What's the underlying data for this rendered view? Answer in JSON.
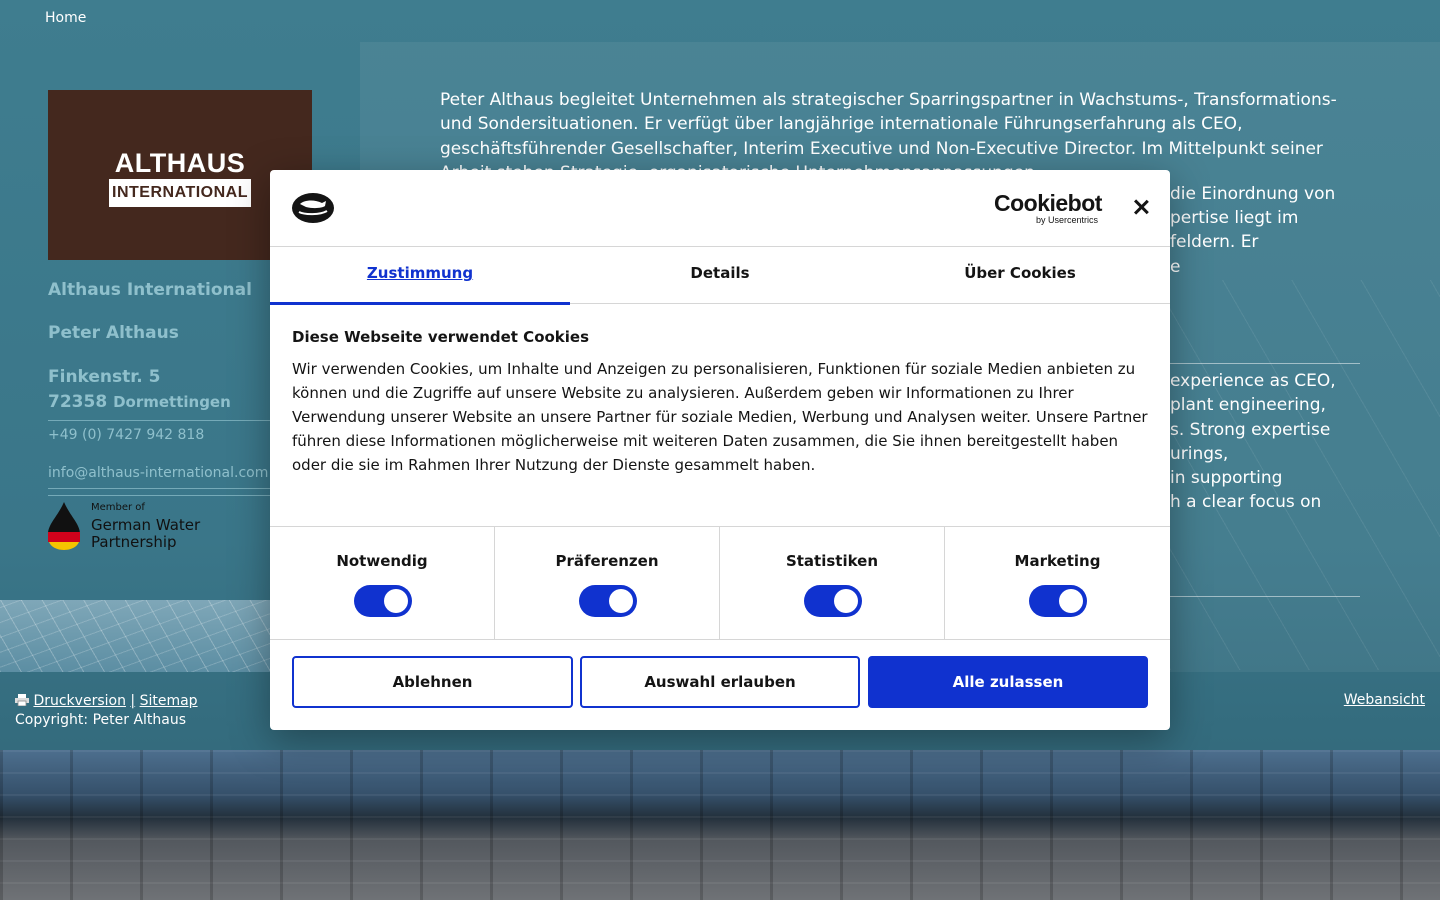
{
  "nav": {
    "home": "Home"
  },
  "sidebar": {
    "logo_line1": "ALTHAUS",
    "logo_line2": "INTERNATIONAL",
    "company": "Althaus International",
    "person": "Peter Althaus",
    "street": "Finkenstr. 5",
    "zip": "72358",
    "town": "Dormettingen",
    "phone": "+49 (0) 7427 942 818",
    "email": "info@althaus-international.com",
    "badge_member": "Member of",
    "badge_name_line1": "German Water",
    "badge_name_line2": "Partnership"
  },
  "main": {
    "intro": "Peter Althaus begleitet Unternehmen als strategischer Sparringspartner in Wachstums-, Transformations- und Sondersituationen. Er verfügt über langjährige internationale Führungserfahrung als CEO, geschäftsführender Gesellschafter, Interim Executive und Non-Executive Director. Im Mittelpunkt seiner Arbeit stehen Strategie, organisatorische Unternehmensanpassungen",
    "visible_fragments": [
      "die Einordnung von",
      "pertise liegt im",
      "feldern. Er",
      "e"
    ],
    "english_fragments": [
      "experience as CEO,",
      "plant engineering,",
      "s. Strong expertise",
      "urings,",
      "in supporting",
      "h a clear focus on"
    ]
  },
  "footer": {
    "print_label": "Druckversion",
    "separator": "|",
    "sitemap_label": "Sitemap",
    "copyright": "Copyright: Peter Althaus",
    "webview_label": "Webansicht"
  },
  "cookie_dialog": {
    "brand": "Cookiebot",
    "brand_sub": "by Usercentrics",
    "tabs": [
      {
        "label": "Zustimmung",
        "active": true
      },
      {
        "label": "Details",
        "active": false
      },
      {
        "label": "Über Cookies",
        "active": false
      }
    ],
    "heading": "Diese Webseite verwendet Cookies",
    "text": "Wir verwenden Cookies, um Inhalte und Anzeigen zu personalisieren, Funktionen für soziale Medien anbieten zu können und die Zugriffe auf unsere Website zu analysieren. Außerdem geben wir Informationen zu Ihrer Verwendung unserer Website an unsere Partner für soziale Medien, Werbung und Analysen weiter. Unsere Partner führen diese Informationen möglicherweise mit weiteren Daten zusammen, die Sie ihnen bereitgestellt haben oder die sie im Rahmen Ihrer Nutzung der Dienste gesammelt haben.",
    "toggles": [
      {
        "label": "Notwendig",
        "on": true
      },
      {
        "label": "Präferenzen",
        "on": true
      },
      {
        "label": "Statistiken",
        "on": true
      },
      {
        "label": "Marketing",
        "on": true
      }
    ],
    "buttons": {
      "decline": "Ablehnen",
      "allow_selection": "Auswahl erlauben",
      "allow_all": "Alle zulassen"
    },
    "accent_color": "#1032cf"
  }
}
